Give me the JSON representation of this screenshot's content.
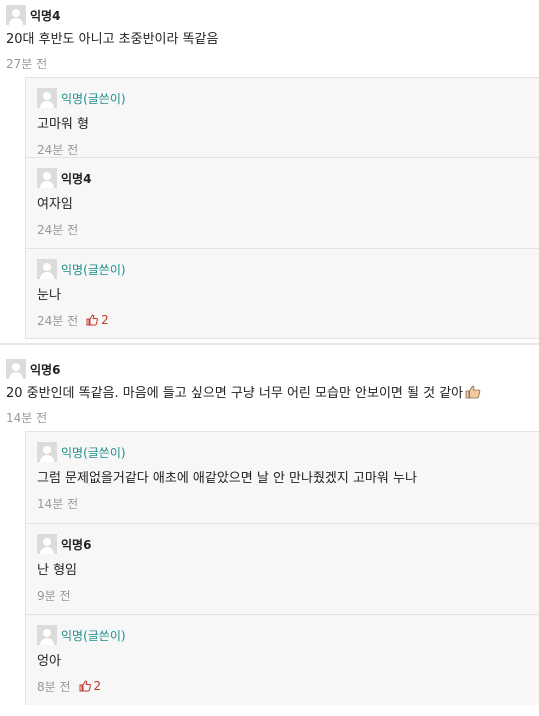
{
  "threads": [
    {
      "author": "익명4",
      "text": "20대 후반도 아니고 초중반이라 똑같음",
      "time": "27분 전",
      "replies": [
        {
          "author": "익명(글쓴이)",
          "is_writer": true,
          "text": "고마워 형",
          "time": "24분 전"
        },
        {
          "author": "익명4",
          "is_writer": false,
          "text": "여자임",
          "time": "24분 전"
        },
        {
          "author": "익명(글쓴이)",
          "is_writer": true,
          "text": "눈나",
          "time": "24분 전",
          "likes": "2"
        }
      ]
    },
    {
      "author": "익명6",
      "text": "20 중반인데 똑같음. 마음에 들고 싶으면 구냥 너무 어린 모습만 안보이면 될 것 같아",
      "emoji": "thumbs-up-icon",
      "time": "14분 전",
      "replies": [
        {
          "author": "익명(글쓴이)",
          "is_writer": true,
          "text": "그럼 문제없을거같다 애초에 애같았으면 날 안 만나줬겠지 고마워 누나",
          "time": "14분 전"
        },
        {
          "author": "익명6",
          "is_writer": false,
          "text": "난 형임",
          "time": "9분 전"
        },
        {
          "author": "익명(글쓴이)",
          "is_writer": true,
          "text": "엉아",
          "time": "8분 전",
          "likes": "2"
        }
      ]
    }
  ]
}
